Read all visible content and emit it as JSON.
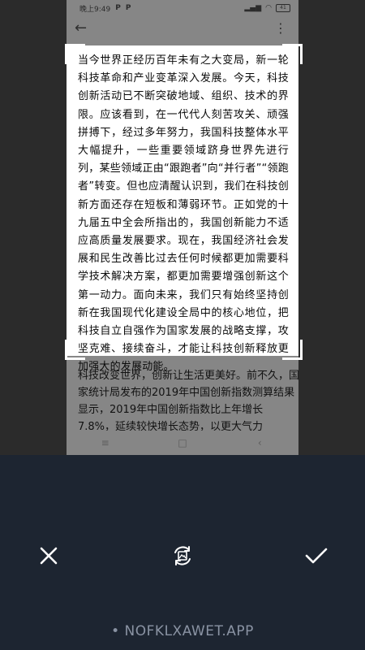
{
  "status_bar": {
    "time": "晚上9:49",
    "notif_a": "P",
    "notif_b": "P",
    "battery": "41"
  },
  "icons": {
    "back": "arrow-left-icon",
    "more": "more-vertical-icon",
    "cancel": "close-icon",
    "rotate": "rotate-image-icon",
    "confirm": "check-icon"
  },
  "document": {
    "cropped_text": "当今世界正经历百年未有之大变局，新一轮科技革命和产业变革深入发展。今天，科技创新活动已不断突破地域、组织、技术的界限。应该看到，在一代代人刻苦攻关、顽强拼搏下，经过多年努力，我国科技整体水平大幅提升，一些重要领域跻身世界先进行列，某些领域正由“跟跑者”向“并行者”“领跑者”转变。但也应清醒认识到，我们在科技创新方面还存在短板和薄弱环节。正如党的十九届五中全会所指出的，我国创新能力不适应高质量发展要求。现在，我国经济社会发展和民生改善比过去任何时候都更加需要科学技术解决方案，都更加需要增强创新这个第一动力。面向未来，我们只有始终坚持创新在我国现代化建设全局中的核心地位，把科技自立自强作为国家发展的战略支撑，攻坚克难、接续奋斗，才能让科技创新释放更加强大的发展动能。",
    "below_crop_text": "科技改变世界，创新让生活更美好。前不久，国家统计局发布的2019年中国创新指数测算结果显示，2019年中国创新指数比上年增长7.8%，延续较快增长态势，以更大气力"
  },
  "nav": {
    "menu": "≡",
    "home": "□",
    "back": "‹"
  },
  "watermark": "• NOFKLXAWET.APP",
  "colors": {
    "toolbar_bg": "#1d2531",
    "crop_bg": "#ffffff",
    "dimmed_bg": "#868686"
  }
}
